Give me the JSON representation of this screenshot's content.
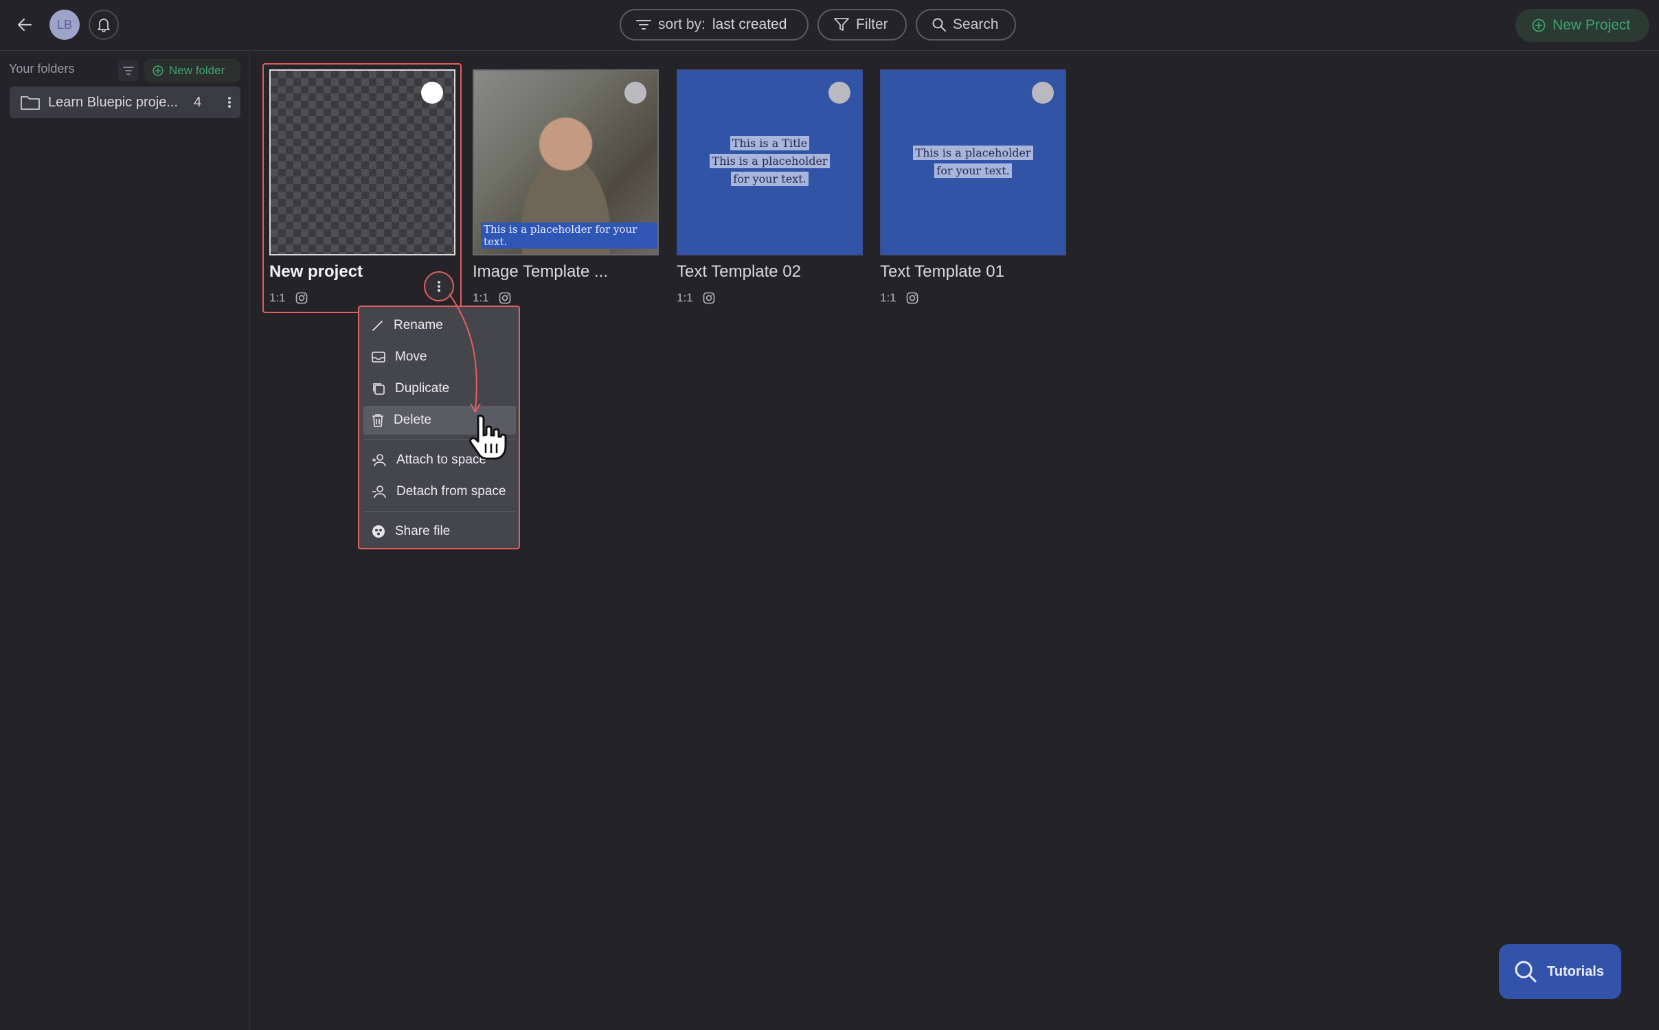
{
  "header": {
    "avatar_initials": "LB",
    "sort_label": "sort by:",
    "sort_value": "last created",
    "filter_label": "Filter",
    "search_label": "Search",
    "new_project_label": "New Project",
    "accent_color": "#3ea36e"
  },
  "sidebar": {
    "title": "Your folders",
    "new_folder_label": "New folder",
    "folders": [
      {
        "label": "Learn Bluepic proje...",
        "count": "4"
      }
    ]
  },
  "projects": [
    {
      "title": "New project",
      "ratio": "1:1",
      "platform_icon": "instagram-icon",
      "selected": true
    },
    {
      "title": "Image Template ...",
      "ratio": "1:1",
      "platform_icon": "instagram-icon",
      "caption": "This is a placeholder for your text."
    },
    {
      "title": "Text Template 02",
      "ratio": "1:1",
      "platform_icon": "instagram-icon",
      "lines": [
        "This is a Title",
        "This is a placeholder",
        "for your text."
      ]
    },
    {
      "title": "Text Template 01",
      "ratio": "1:1",
      "platform_icon": "instagram-icon",
      "lines": [
        "This is a placeholder",
        "for your text."
      ]
    }
  ],
  "context_menu": {
    "items": [
      {
        "label": "Rename",
        "icon": "pencil-icon"
      },
      {
        "label": "Move",
        "icon": "inbox-icon"
      },
      {
        "label": "Duplicate",
        "icon": "copy-icon"
      },
      {
        "label": "Delete",
        "icon": "trash-icon",
        "hovered": true
      },
      {
        "label": "Attach to space",
        "icon": "user-plus-icon"
      },
      {
        "label": "Detach from space",
        "icon": "user-minus-icon"
      },
      {
        "label": "Share file",
        "icon": "share-icon"
      }
    ]
  },
  "tutorials_label": "Tutorials"
}
